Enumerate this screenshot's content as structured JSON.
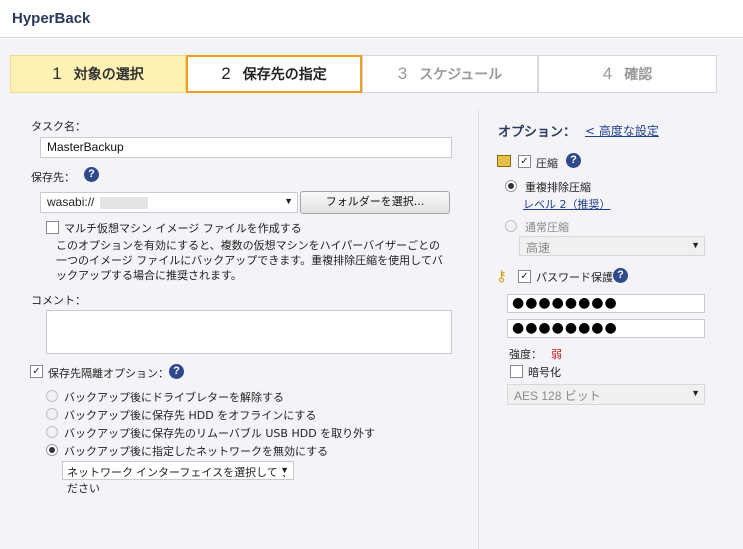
{
  "app": {
    "title": "HyperBack"
  },
  "steps": [
    {
      "num": "1",
      "label": "対象の選択"
    },
    {
      "num": "2",
      "label": "保存先の指定"
    },
    {
      "num": "3",
      "label": "スケジュール"
    },
    {
      "num": "4",
      "label": "確認"
    }
  ],
  "left": {
    "task_name_label": "タスク名：",
    "task_name_value": "MasterBackup",
    "destination_label": "保存先：",
    "destination_value": "wasabi://",
    "select_folder_button": "フォルダーを選択...",
    "multi_vm_label": "マルチ仮想マシン イメージ ファイルを作成する",
    "multi_vm_desc": "このオプションを有効にすると、複数の仮想マシンをハイパーバイザーごとの一つのイメージ ファイルにバックアップできます。重複排除圧縮を使用してバックアップする場合に推奨されます。",
    "comment_label": "コメント：",
    "isolation_label": "保存先隔離オプション：",
    "isolation_options": [
      "バックアップ後にドライブレターを解除する",
      "バックアップ後に保存先 HDD をオフラインにする",
      "バックアップ後に保存先のリムーバブル USB HDD を取り外す",
      "バックアップ後に指定したネットワークを無効にする"
    ],
    "network_select": "ネットワーク インターフェイスを選択してください"
  },
  "right": {
    "options_title": "オプション：",
    "advanced_link": "< 高度な設定",
    "compression_label": "圧縮",
    "dedup_label": "重複排除圧縮",
    "dedup_level_link": "レベル 2（推奨）",
    "normal_label": "通常圧縮",
    "normal_select": "高速",
    "password_label": "パスワード保護",
    "password_value": "●●●●●●●●",
    "password_confirm": "●●●●●●●●",
    "strength_label": "強度：",
    "strength_value": "弱",
    "encrypt_label": "暗号化",
    "encrypt_select": "AES 128 ビット"
  },
  "colors": {
    "accent": "#f09c1e",
    "step1_bg": "#fdf2b3",
    "brand": "#2a3a5c",
    "weak": "#cc2222"
  }
}
